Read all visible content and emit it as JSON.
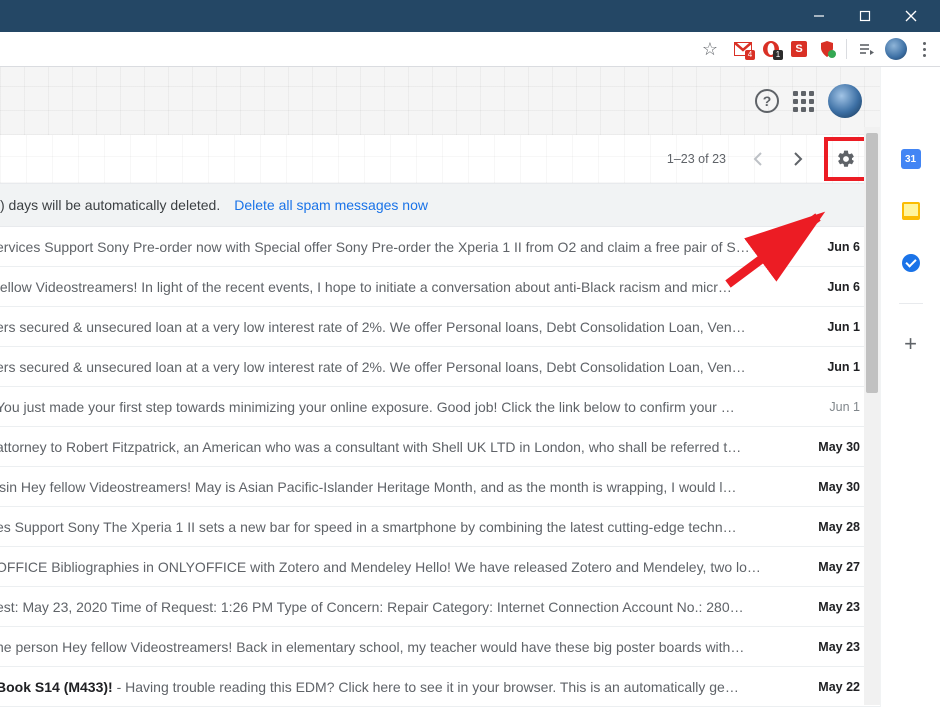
{
  "window": {
    "minimize": "–",
    "maximize": "",
    "close": ""
  },
  "chrome": {
    "gmail_badge": "4",
    "opera_badge": "1"
  },
  "gmail_header": {},
  "toolbar": {
    "pager": "1–23 of 23"
  },
  "banner": {
    "text": ") days will be automatically deleted.",
    "link": "Delete all spam messages now"
  },
  "side": {
    "cal_day": "31"
  },
  "messages": [
    {
      "snippet": "ervices Support Sony Pre-order now with Special offer Sony Pre-order the Xperia 1 II from O2 and claim a free pair of S…",
      "date": "Jun 6",
      "read": false
    },
    {
      "snippet": "fellow Videostreamers! In light of the recent events, I hope to initiate a conversation about anti-Black racism and micr…",
      "date": "Jun 6",
      "read": false
    },
    {
      "snippet": "ers secured & unsecured loan at a very low interest rate of 2%. We offer Personal loans, Debt Consolidation Loan, Ven…",
      "date": "Jun 1",
      "read": false
    },
    {
      "snippet": "ers secured & unsecured loan at a very low interest rate of 2%. We offer Personal loans, Debt Consolidation Loan, Ven…",
      "date": "Jun 1",
      "read": false
    },
    {
      "snippet": "You just made your first step towards minimizing your online exposure. Good job! Click the link below to confirm your …",
      "date": "Jun 1",
      "read": true
    },
    {
      "snippet": "attorney to Robert Fitzpatrick, an American who was a consultant with Shell UK LTD in London, who shall be referred t…",
      "date": "May 30",
      "read": false
    },
    {
      "snippet": "isin Hey fellow Videostreamers! May is Asian Pacific-Islander Heritage Month, and as the month is wrapping, I would l…",
      "date": "May 30",
      "read": false
    },
    {
      "snippet": "es Support Sony The Xperia 1 II sets a new bar for speed in a smartphone by combining the latest cutting-edge techn…",
      "date": "May 28",
      "read": false
    },
    {
      "snippet": "OFFICE Bibliographies in ONLYOFFICE with Zotero and Mendeley Hello! We have released Zotero and Mendeley, two lo…",
      "date": "May 27",
      "read": false
    },
    {
      "snippet": "est: May 23, 2020 Time of Request: 1:26 PM Type of Concern: Repair Category: Internet Connection Account No.: 280…",
      "date": "May 23",
      "read": false
    },
    {
      "snippet": "ne person Hey fellow Videostreamers! Back in elementary school, my teacher would have these big poster boards with…",
      "date": "May 23",
      "read": false
    },
    {
      "snippet_bold": "Book S14 (M433)!",
      "snippet_rest": " - Having trouble reading this EDM? Click here to see it in your browser. This is an automatically ge…",
      "date": "May 22",
      "read": false
    }
  ]
}
